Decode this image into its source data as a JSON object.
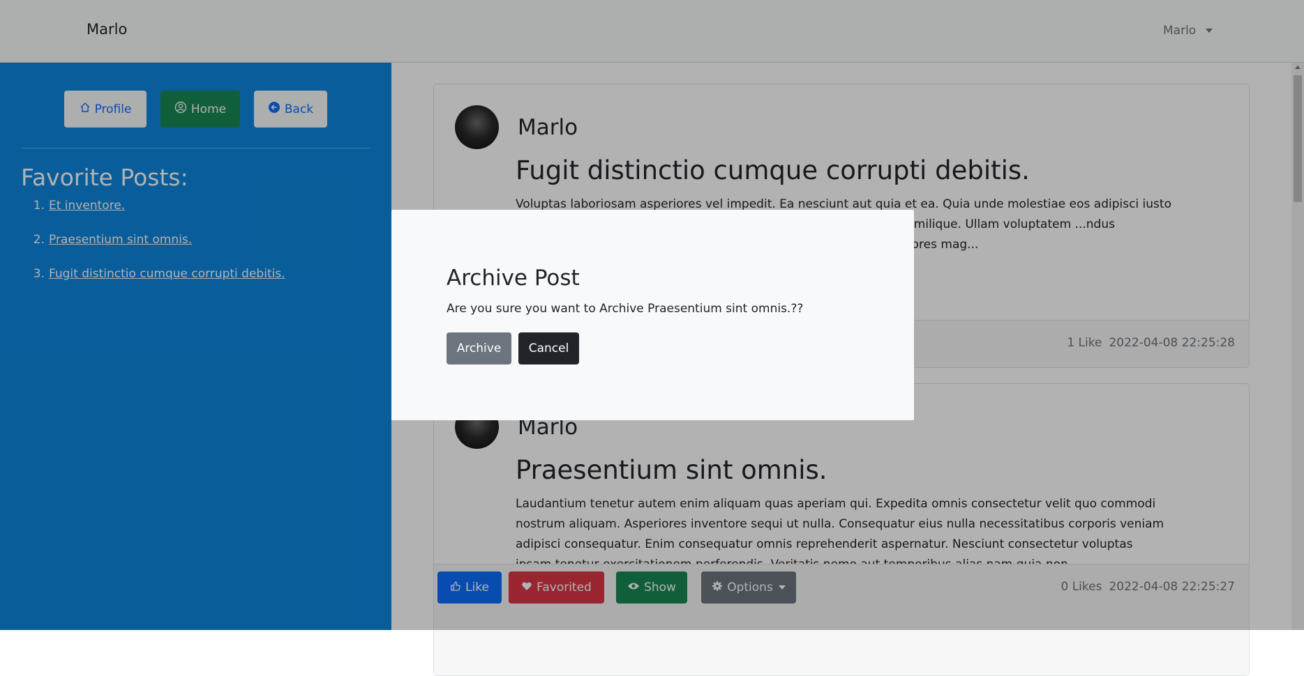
{
  "navbar": {
    "brand": "Marlo",
    "user_menu": "Marlo"
  },
  "sidebar": {
    "buttons": {
      "profile": "Profile",
      "home": "Home",
      "back": "Back"
    },
    "favorites_title": "Favorite Posts:",
    "favorites": [
      {
        "num": "1.",
        "label": "Et inventore."
      },
      {
        "num": "2.",
        "label": "Praesentium sint omnis."
      },
      {
        "num": "3.",
        "label": "Fugit distinctio cumque corrupti debitis."
      }
    ]
  },
  "posts": [
    {
      "author": "Marlo",
      "title": "Fugit distinctio cumque corrupti debitis.",
      "body": "Voluptas laboriosam asperiores vel impedit. Ea nesciunt aut quia et ea. Quia unde molestiae eos adipisci iusto ...us officia. Voluptatem dicta aperiam ut quas. ...gnissimos illum similique. Ullam voluptatem ...ndus consequuntur reprehenderit in ...luta quibusdam eos reiciendis dolores mag...",
      "likes": "1 Like",
      "date": "2022-04-08 22:25:28"
    },
    {
      "author": "Marlo",
      "title": "Praesentium sint omnis.",
      "body": "Laudantium tenetur autem enim aliquam quas aperiam qui. Expedita omnis consectetur velit quo commodi nostrum aliquam. Asperiores inventore sequi ut nulla. Consequatur eius nulla necessitatibus corporis veniam adipisci consequatur. Enim consequatur omnis reprehenderit aspernatur. Nesciunt consectetur voluptas ipsam tenetur exercitationem perferendis. Veritatis nemo aut temporibus alias nam quia non.",
      "likes": "0 Likes",
      "date": "2022-04-08 22:25:27",
      "buttons": {
        "like": "Like",
        "favorited": "Favorited",
        "show": "Show",
        "options": "Options"
      }
    }
  ],
  "modal": {
    "title": "Archive Post",
    "text": "Are you sure you want to Archive Praesentium sint omnis.??",
    "archive": "Archive",
    "cancel": "Cancel"
  },
  "colors": {
    "sidebar": "#0d86dd",
    "success": "#198754",
    "primary": "#0d6efd",
    "danger": "#dc3545",
    "secondary": "#6c757d",
    "dark": "#212529"
  }
}
